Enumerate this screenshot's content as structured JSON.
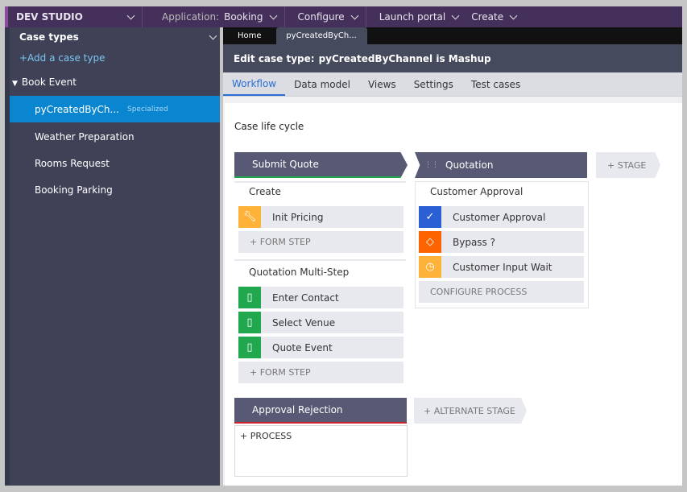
{
  "topbar": {
    "brand": "DEV STUDIO",
    "application_label": "Application:",
    "application_value": "Booking",
    "configure": "Configure",
    "launch_portal": "Launch portal",
    "create": "Create"
  },
  "sidebar": {
    "title": "Case types",
    "add": "+Add a case type",
    "parent": "Book Event",
    "items": [
      {
        "label": "pyCreatedByCh...",
        "badge": "Specialized",
        "selected": true
      },
      {
        "label": "Weather Preparation"
      },
      {
        "label": "Rooms Request"
      },
      {
        "label": "Booking Parking"
      }
    ]
  },
  "portal_tabs": [
    "Home",
    "pyCreatedByCh..."
  ],
  "header": {
    "prefix": "Edit case type:",
    "name": "pyCreatedByChannel is Mashup"
  },
  "tabs": [
    "Workflow",
    "Data model",
    "Views",
    "Settings",
    "Test cases"
  ],
  "content": {
    "title": "Case life cycle",
    "stages": [
      {
        "label": "Submit Quote"
      },
      {
        "label": "Quotation"
      }
    ],
    "add_stage": "+ STAGE",
    "add_alt_stage": "+ ALTERNATE STAGE",
    "submit_quote": {
      "processes": [
        {
          "name": "Create",
          "steps": [
            {
              "label": "Init Pricing",
              "icon": "wrench-icon"
            }
          ],
          "add": "+ FORM STEP"
        },
        {
          "name": "Quotation Multi-Step",
          "steps": [
            {
              "label": "Enter Contact",
              "icon": "clipboard-icon"
            },
            {
              "label": "Select Venue",
              "icon": "clipboard-icon"
            },
            {
              "label": "Quote Event",
              "icon": "clipboard-icon"
            }
          ],
          "add": "+ FORM STEP"
        }
      ]
    },
    "quotation": {
      "process": "Customer Approval",
      "steps": [
        {
          "label": "Customer Approval",
          "icon": "check-icon"
        },
        {
          "label": "Bypass ?",
          "icon": "diamond-icon"
        },
        {
          "label": "Customer Input Wait",
          "icon": "clock-icon"
        }
      ],
      "configure": "CONFIGURE PROCESS"
    },
    "alt_stage": {
      "label": "Approval Rejection",
      "add_process": "+ PROCESS"
    }
  },
  "colors": {
    "accent": "#2a6fd6",
    "selected": "#0a86d0",
    "green": "#21a84e",
    "orange": "#fd6400",
    "amber": "#ffb23a",
    "blue": "#2a5fd6",
    "alt_red": "#d0202b"
  }
}
